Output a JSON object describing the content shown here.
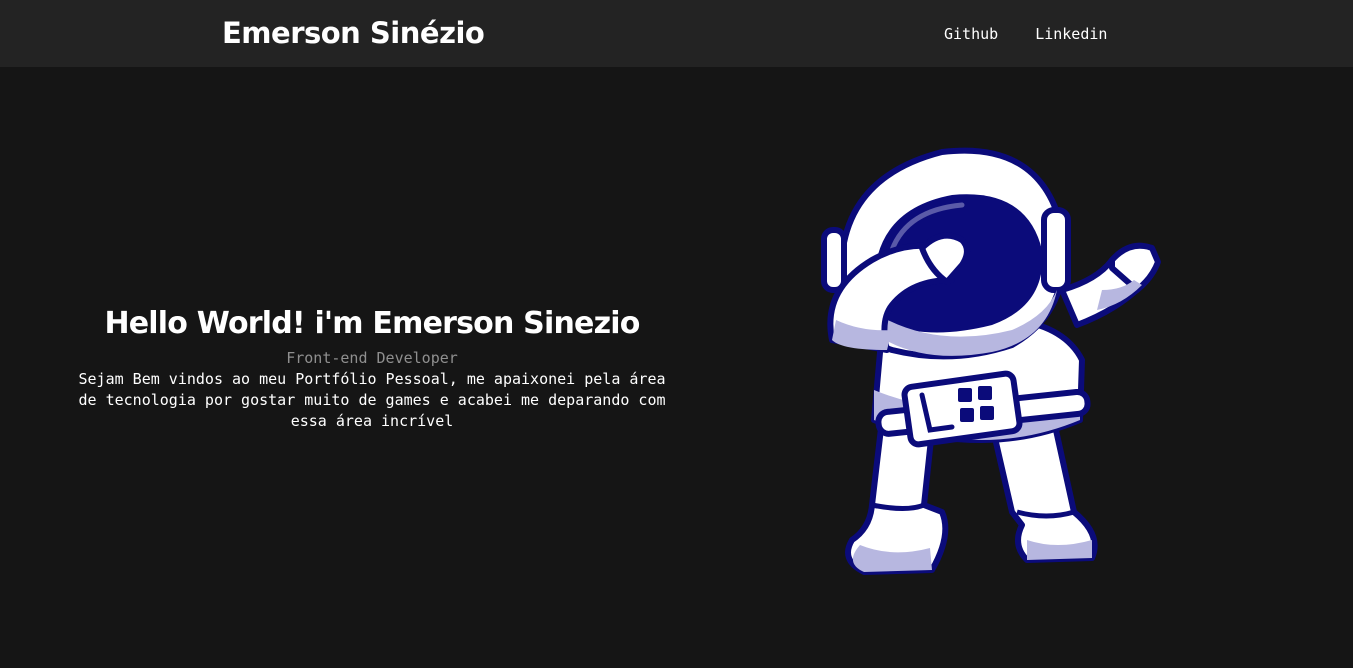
{
  "header": {
    "brand": "Emerson Sinézio",
    "nav": [
      {
        "label": "Github"
      },
      {
        "label": "Linkedin"
      }
    ]
  },
  "hero": {
    "title": "Hello World! i'm Emerson Sinezio",
    "subtitle": "Front-end Developer",
    "description": "Sejam Bem vindos ao meu Portfólio Pessoal, me apaixonei pela área de tecnologia por gostar muito de games e acabei me deparando com essa área incrível",
    "illustration": "astronaut-dabbing-illustration"
  },
  "colors": {
    "page_background": "#151515",
    "header_background": "#232323",
    "text": "#ffffff",
    "muted_text": "#8f8f8f",
    "navy": "#0b0b7a",
    "suit_white": "#ffffff",
    "suit_shade": "#b7b7e0"
  }
}
